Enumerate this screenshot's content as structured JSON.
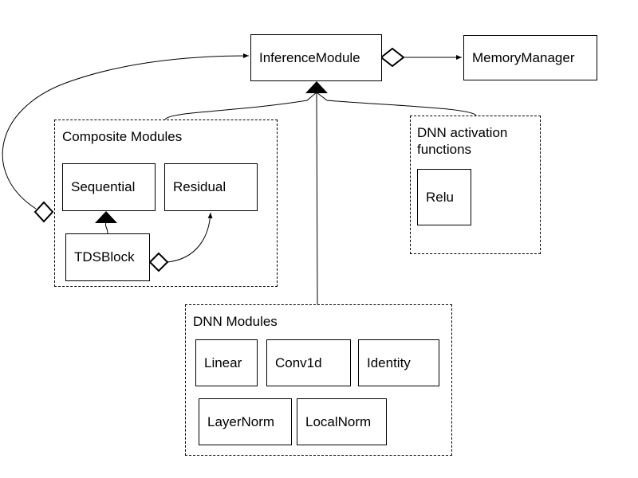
{
  "classes": {
    "inference_module": "InferenceModule",
    "memory_manager": "MemoryManager"
  },
  "groups": {
    "composite": {
      "title": "Composite Modules",
      "items": [
        "Sequential",
        "Residual",
        "TDSBlock"
      ]
    },
    "activation": {
      "title": "DNN activation functions",
      "items": [
        "Relu"
      ]
    },
    "dnn": {
      "title": "DNN Modules",
      "items": [
        "Linear",
        "Conv1d",
        "Identity",
        "LayerNorm",
        "LocalNorm"
      ]
    }
  },
  "relations": [
    {
      "from": "InferenceModule",
      "to": "MemoryManager",
      "type": "aggregation"
    },
    {
      "from": "Composite Modules",
      "to": "InferenceModule",
      "type": "inheritance"
    },
    {
      "from": "DNN activation functions",
      "to": "InferenceModule",
      "type": "inheritance"
    },
    {
      "from": "DNN Modules",
      "to": "InferenceModule",
      "type": "inheritance"
    },
    {
      "from": "Composite Modules",
      "to": "InferenceModule",
      "type": "aggregation"
    },
    {
      "from": "TDSBlock",
      "to": "Sequential",
      "type": "inheritance"
    },
    {
      "from": "TDSBlock",
      "to": "Residual",
      "type": "aggregation"
    }
  ]
}
